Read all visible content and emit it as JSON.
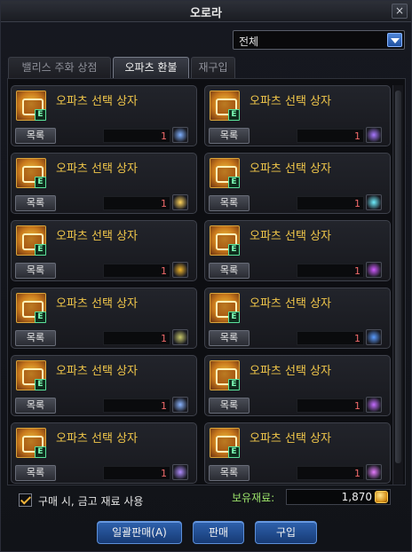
{
  "window": {
    "title": "오로라",
    "close_label": "×"
  },
  "filter": {
    "selected": "전체"
  },
  "tabs": [
    {
      "label": "밸리스 주화 상점"
    },
    {
      "label": "오파츠 환불"
    },
    {
      "label": "재구입"
    }
  ],
  "items": [
    {
      "name": "오파츠 선택 상자",
      "button": "목록",
      "quantity": "1",
      "material_icon": "spiral-icon",
      "icon_color": "#7fb0ff"
    },
    {
      "name": "오파츠 선택 상자",
      "button": "목록",
      "quantity": "1",
      "material_icon": "dragon-icon",
      "icon_color": "#a878ff"
    },
    {
      "name": "오파츠 선택 상자",
      "button": "목록",
      "quantity": "1",
      "material_icon": "star-burst-icon",
      "icon_color": "#ffd35a"
    },
    {
      "name": "오파츠 선택 상자",
      "button": "목록",
      "quantity": "1",
      "material_icon": "crystal-flower-icon",
      "icon_color": "#6ff0ff"
    },
    {
      "name": "오파츠 선택 상자",
      "button": "목록",
      "quantity": "1",
      "material_icon": "gold-box-icon",
      "icon_color": "#f0b429"
    },
    {
      "name": "오파츠 선택 상자",
      "button": "목록",
      "quantity": "1",
      "material_icon": "purple-gem-icon",
      "icon_color": "#d05aff"
    },
    {
      "name": "오파츠 선택 상자",
      "button": "목록",
      "quantity": "1",
      "material_icon": "gear-coin-icon",
      "icon_color": "#c8c86a"
    },
    {
      "name": "오파츠 선택 상자",
      "button": "목록",
      "quantity": "1",
      "material_icon": "blue-orb-icon",
      "icon_color": "#5a9cff"
    },
    {
      "name": "오파츠 선택 상자",
      "button": "목록",
      "quantity": "1",
      "material_icon": "lightning-icon",
      "icon_color": "#8ab4ff"
    },
    {
      "name": "오파츠 선택 상자",
      "button": "목록",
      "quantity": "1",
      "material_icon": "violet-fairy-icon",
      "icon_color": "#c46cff"
    },
    {
      "name": "오파츠 선택 상자",
      "button": "목록",
      "quantity": "1",
      "material_icon": "feather-icon",
      "icon_color": "#b08cff"
    },
    {
      "name": "오파츠 선택 상자",
      "button": "목록",
      "quantity": "1",
      "material_icon": "pink-spark-icon",
      "icon_color": "#e67cff"
    }
  ],
  "footer": {
    "use_storage_checked": true,
    "use_storage_label": "구매 시, 금고 재료 사용",
    "holdings_label": "보유재료:",
    "holdings_value": "1,870",
    "buttons": {
      "bulk_sell": "일괄판매(A)",
      "sell": "판매",
      "buy": "구입"
    }
  },
  "colors": {
    "item_name": "#f1c74a",
    "quantity": "#f06a6a",
    "holdings_label": "#9be26a",
    "button_blue": "#2f62ae"
  }
}
